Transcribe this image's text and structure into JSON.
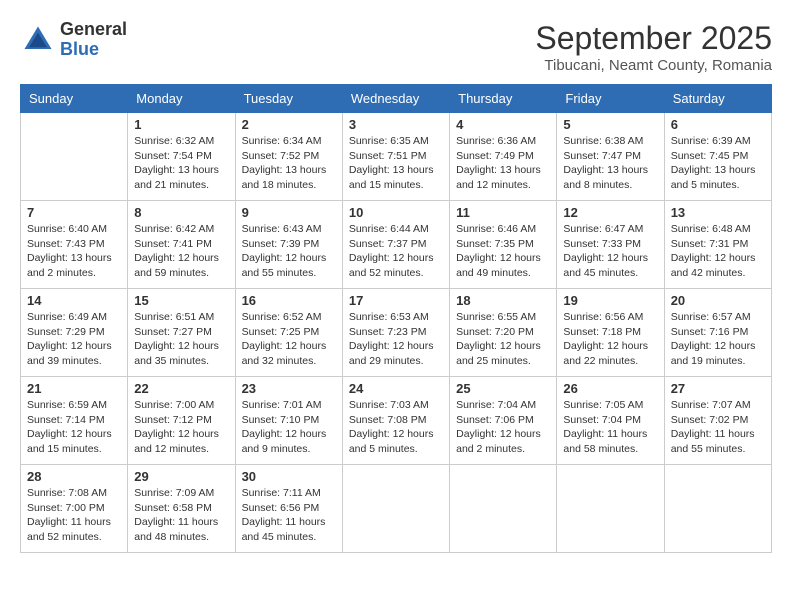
{
  "header": {
    "logo": {
      "general": "General",
      "blue": "Blue"
    },
    "title": "September 2025",
    "location": "Tibucani, Neamt County, Romania"
  },
  "weekdays": [
    "Sunday",
    "Monday",
    "Tuesday",
    "Wednesday",
    "Thursday",
    "Friday",
    "Saturday"
  ],
  "weeks": [
    [
      {
        "day": "",
        "info": ""
      },
      {
        "day": "1",
        "info": "Sunrise: 6:32 AM\nSunset: 7:54 PM\nDaylight: 13 hours and 21 minutes."
      },
      {
        "day": "2",
        "info": "Sunrise: 6:34 AM\nSunset: 7:52 PM\nDaylight: 13 hours and 18 minutes."
      },
      {
        "day": "3",
        "info": "Sunrise: 6:35 AM\nSunset: 7:51 PM\nDaylight: 13 hours and 15 minutes."
      },
      {
        "day": "4",
        "info": "Sunrise: 6:36 AM\nSunset: 7:49 PM\nDaylight: 13 hours and 12 minutes."
      },
      {
        "day": "5",
        "info": "Sunrise: 6:38 AM\nSunset: 7:47 PM\nDaylight: 13 hours and 8 minutes."
      },
      {
        "day": "6",
        "info": "Sunrise: 6:39 AM\nSunset: 7:45 PM\nDaylight: 13 hours and 5 minutes."
      }
    ],
    [
      {
        "day": "7",
        "info": "Sunrise: 6:40 AM\nSunset: 7:43 PM\nDaylight: 13 hours and 2 minutes."
      },
      {
        "day": "8",
        "info": "Sunrise: 6:42 AM\nSunset: 7:41 PM\nDaylight: 12 hours and 59 minutes."
      },
      {
        "day": "9",
        "info": "Sunrise: 6:43 AM\nSunset: 7:39 PM\nDaylight: 12 hours and 55 minutes."
      },
      {
        "day": "10",
        "info": "Sunrise: 6:44 AM\nSunset: 7:37 PM\nDaylight: 12 hours and 52 minutes."
      },
      {
        "day": "11",
        "info": "Sunrise: 6:46 AM\nSunset: 7:35 PM\nDaylight: 12 hours and 49 minutes."
      },
      {
        "day": "12",
        "info": "Sunrise: 6:47 AM\nSunset: 7:33 PM\nDaylight: 12 hours and 45 minutes."
      },
      {
        "day": "13",
        "info": "Sunrise: 6:48 AM\nSunset: 7:31 PM\nDaylight: 12 hours and 42 minutes."
      }
    ],
    [
      {
        "day": "14",
        "info": "Sunrise: 6:49 AM\nSunset: 7:29 PM\nDaylight: 12 hours and 39 minutes."
      },
      {
        "day": "15",
        "info": "Sunrise: 6:51 AM\nSunset: 7:27 PM\nDaylight: 12 hours and 35 minutes."
      },
      {
        "day": "16",
        "info": "Sunrise: 6:52 AM\nSunset: 7:25 PM\nDaylight: 12 hours and 32 minutes."
      },
      {
        "day": "17",
        "info": "Sunrise: 6:53 AM\nSunset: 7:23 PM\nDaylight: 12 hours and 29 minutes."
      },
      {
        "day": "18",
        "info": "Sunrise: 6:55 AM\nSunset: 7:20 PM\nDaylight: 12 hours and 25 minutes."
      },
      {
        "day": "19",
        "info": "Sunrise: 6:56 AM\nSunset: 7:18 PM\nDaylight: 12 hours and 22 minutes."
      },
      {
        "day": "20",
        "info": "Sunrise: 6:57 AM\nSunset: 7:16 PM\nDaylight: 12 hours and 19 minutes."
      }
    ],
    [
      {
        "day": "21",
        "info": "Sunrise: 6:59 AM\nSunset: 7:14 PM\nDaylight: 12 hours and 15 minutes."
      },
      {
        "day": "22",
        "info": "Sunrise: 7:00 AM\nSunset: 7:12 PM\nDaylight: 12 hours and 12 minutes."
      },
      {
        "day": "23",
        "info": "Sunrise: 7:01 AM\nSunset: 7:10 PM\nDaylight: 12 hours and 9 minutes."
      },
      {
        "day": "24",
        "info": "Sunrise: 7:03 AM\nSunset: 7:08 PM\nDaylight: 12 hours and 5 minutes."
      },
      {
        "day": "25",
        "info": "Sunrise: 7:04 AM\nSunset: 7:06 PM\nDaylight: 12 hours and 2 minutes."
      },
      {
        "day": "26",
        "info": "Sunrise: 7:05 AM\nSunset: 7:04 PM\nDaylight: 11 hours and 58 minutes."
      },
      {
        "day": "27",
        "info": "Sunrise: 7:07 AM\nSunset: 7:02 PM\nDaylight: 11 hours and 55 minutes."
      }
    ],
    [
      {
        "day": "28",
        "info": "Sunrise: 7:08 AM\nSunset: 7:00 PM\nDaylight: 11 hours and 52 minutes."
      },
      {
        "day": "29",
        "info": "Sunrise: 7:09 AM\nSunset: 6:58 PM\nDaylight: 11 hours and 48 minutes."
      },
      {
        "day": "30",
        "info": "Sunrise: 7:11 AM\nSunset: 6:56 PM\nDaylight: 11 hours and 45 minutes."
      },
      {
        "day": "",
        "info": ""
      },
      {
        "day": "",
        "info": ""
      },
      {
        "day": "",
        "info": ""
      },
      {
        "day": "",
        "info": ""
      }
    ]
  ]
}
